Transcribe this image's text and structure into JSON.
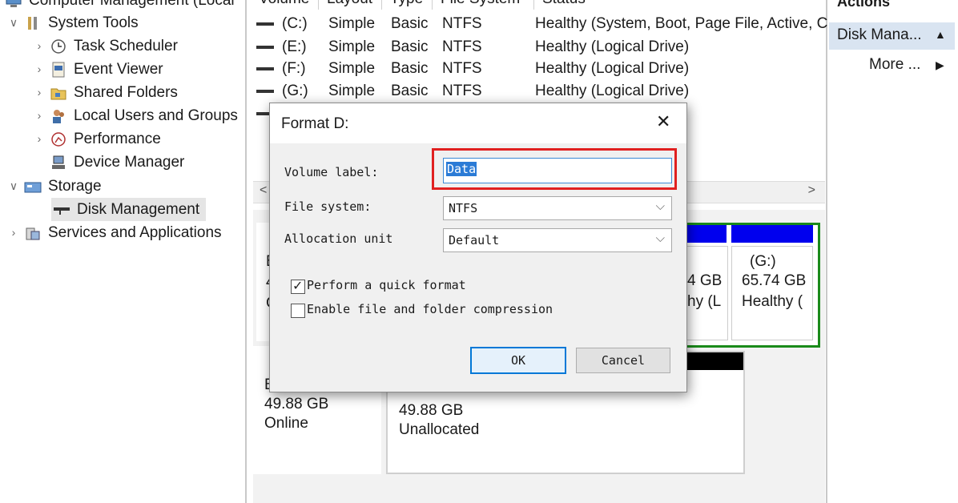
{
  "tree": {
    "root": "Computer Management (Local",
    "system_tools": "System Tools",
    "task_scheduler": "Task Scheduler",
    "event_viewer": "Event Viewer",
    "shared_folders": "Shared Folders",
    "local_users": "Local Users and Groups",
    "performance": "Performance",
    "device_manager": "Device Manager",
    "storage": "Storage",
    "disk_management": "Disk Management",
    "services": "Services and Applications"
  },
  "volume_list": {
    "headers": [
      "Volume",
      "Layout",
      "Type",
      "File System",
      "Status"
    ],
    "rows": [
      {
        "volume": "(C:)",
        "layout": "Simple",
        "type": "Basic",
        "fs": "NTFS",
        "status": "Healthy (System, Boot, Page File, Active, C"
      },
      {
        "volume": "(E:)",
        "layout": "Simple",
        "type": "Basic",
        "fs": "NTFS",
        "status": "Healthy (Logical Drive)"
      },
      {
        "volume": "(F:)",
        "layout": "Simple",
        "type": "Basic",
        "fs": "NTFS",
        "status": "Healthy (Logical Drive)"
      },
      {
        "volume": "(G:)",
        "layout": "Simple",
        "type": "Basic",
        "fs": "NTFS",
        "status": "Healthy (Logical Drive)"
      }
    ]
  },
  "disk_view": {
    "partial_size": "4 GB",
    "partial_status": "hy (L",
    "g_label": "(G:)",
    "g_size": "65.74 GB",
    "g_status": "Healthy (",
    "disk1_left_1": "B",
    "disk1_left_2": "4",
    "disk1_left_3": "C",
    "disk2_type": "B",
    "disk2_size": "49.88 GB",
    "disk2_state": "Online",
    "unalloc_size": "49.88 GB",
    "unalloc_label": "Unallocated"
  },
  "actions": {
    "title": "Actions",
    "selected": "Disk Mana...",
    "more": "More ...",
    "up_arrow": "▲",
    "right_arrow": "▶"
  },
  "dialog": {
    "title": "Format D:",
    "close": "✕",
    "volume_label_caption": "Volume label:",
    "volume_label_value": "Data",
    "file_system_caption": "File system:",
    "file_system_value": "NTFS",
    "allocation_caption": "Allocation unit",
    "allocation_value": "Default",
    "quick_format_label": "Perform a quick format",
    "quick_format_checked": true,
    "compression_label": "Enable file and folder compression",
    "compression_checked": false,
    "ok": "OK",
    "cancel": "Cancel"
  },
  "colors": {
    "highlight_red": "#e02020",
    "partition_blue": "#0000ee",
    "logical_green": "#1a8a1a",
    "selection_blue": "#d9e4f1"
  },
  "icons": {
    "checkmark": "✓",
    "chevron_down": "⌵",
    "scroll_left": "<",
    "scroll_right": ">"
  }
}
